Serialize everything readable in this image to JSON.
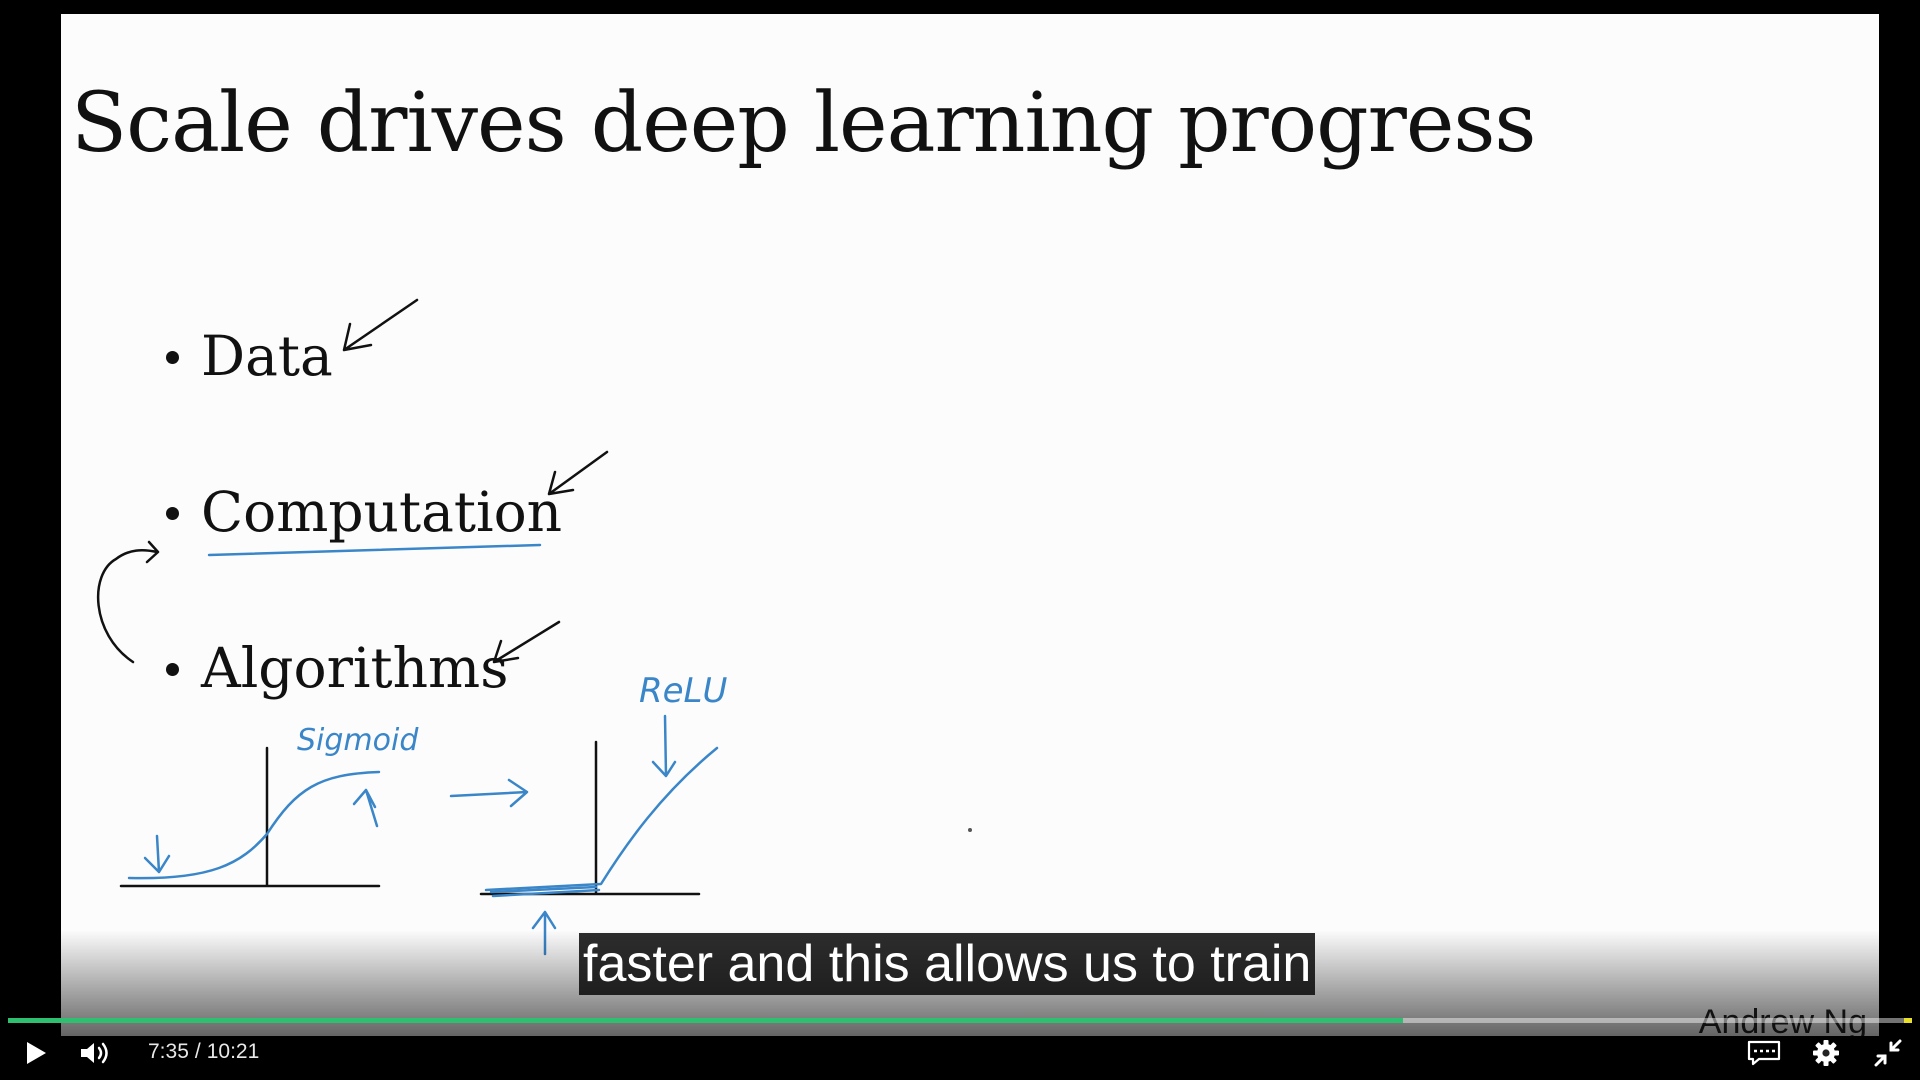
{
  "slide": {
    "title": "Scale drives deep learning progress",
    "bullets": [
      "Data",
      "Computation",
      "Algorithms"
    ],
    "annotations": {
      "sigmoid": "Sigmoid",
      "relu": "ReLU"
    },
    "author": "Andrew Ng"
  },
  "caption": "faster and this allows us to train",
  "player": {
    "current_time": "7:35",
    "separator": "/",
    "duration": "10:21",
    "progress": 0.7327,
    "colors": {
      "progress": "#2fbf71",
      "end_marker": "#e8e02a",
      "ink_blue": "#3a86c8"
    },
    "icons": [
      "play-icon",
      "volume-icon",
      "captions-icon",
      "settings-icon",
      "exit-fullscreen-icon"
    ]
  }
}
